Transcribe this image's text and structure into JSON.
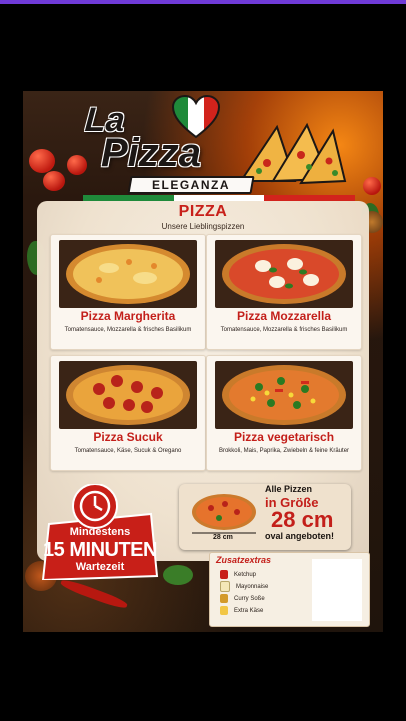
{
  "logo": {
    "line1": "La",
    "line2": "Pizza",
    "line3": "ELEGANZA"
  },
  "section": {
    "title": "PIZZA",
    "subtitle": "Unsere Lieblingspizzen"
  },
  "menu_items": [
    {
      "name": "Pizza Margherita",
      "description": "Tomatensauce, Mozzarella & frisches Basilikum"
    },
    {
      "name": "Pizza Mozzarella",
      "description": "Tomatensauce, Mozzarella & frisches Basilikum"
    },
    {
      "name": "Pizza Sucuk",
      "description": "Tomatensauce, Käse, Sucuk & Oregano"
    },
    {
      "name": "Pizza vegetarisch",
      "description": "Brokkoli, Mais, Paprika, Zwiebeln & feine Kräuter"
    }
  ],
  "timer": {
    "line1": "Mindestens",
    "line2": "15 MINUTEN",
    "line3": "Wartezeit"
  },
  "size_info": {
    "line1": "Alle Pizzen",
    "line2": "in Größe",
    "line3": "28 cm",
    "line4": "oval angeboten!",
    "small_label": "28 cm"
  },
  "extras": {
    "title": "Zusatzextras",
    "items": [
      "Ketchup",
      "Mayonnaise",
      "Curry Soße",
      "Extra Käse"
    ]
  },
  "colors": {
    "accent_red": "#c31f1a",
    "flag_green": "#1f8a3a",
    "flag_white": "#ffffff",
    "flag_red": "#d2231c",
    "cream": "#f6eee2"
  }
}
